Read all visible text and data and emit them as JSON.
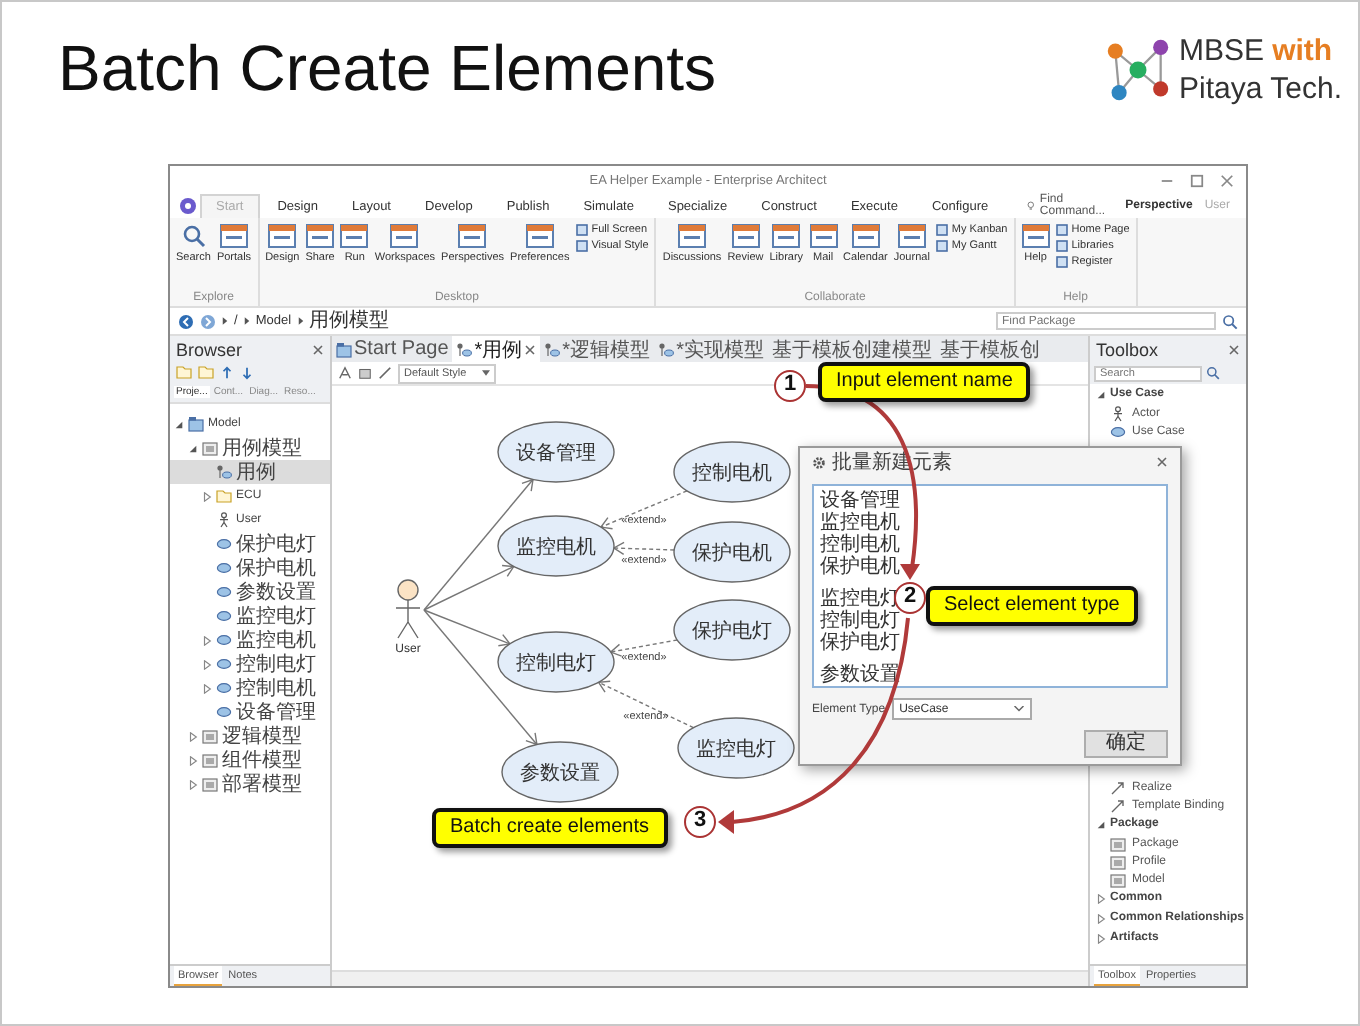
{
  "slide": {
    "title": "Batch Create Elements"
  },
  "logo": {
    "brand": "MBSE",
    "accent": "with",
    "company": "Pitaya Tech."
  },
  "window": {
    "title": "EA Helper Example - Enterprise Architect"
  },
  "ribbon": {
    "tabs": [
      {
        "label": "Start",
        "selected": true
      },
      {
        "label": "Design",
        "selected": false
      },
      {
        "label": "Layout",
        "selected": false
      },
      {
        "label": "Develop",
        "selected": false
      },
      {
        "label": "Publish",
        "selected": false
      },
      {
        "label": "Simulate",
        "selected": false
      },
      {
        "label": "Specialize",
        "selected": false
      },
      {
        "label": "Construct",
        "selected": false
      },
      {
        "label": "Execute",
        "selected": false
      },
      {
        "label": "Configure",
        "selected": false
      }
    ],
    "find_command": "Find Command...",
    "perspective": "Perspective",
    "user": "User",
    "groups": [
      {
        "name": "Explore",
        "items": [
          {
            "label": "Search",
            "kind": "search"
          },
          {
            "label": "Portals",
            "kind": "large"
          }
        ]
      },
      {
        "name": "Desktop",
        "items": [
          {
            "label": "Design",
            "kind": "large"
          },
          {
            "label": "Share",
            "kind": "large"
          },
          {
            "label": "Run",
            "kind": "large"
          },
          {
            "label": "Workspaces",
            "kind": "large"
          },
          {
            "label": "Perspectives",
            "kind": "large"
          },
          {
            "label": "Preferences",
            "kind": "large"
          },
          {
            "label": "Full Screen",
            "kind": "small"
          },
          {
            "label": "Visual Style",
            "kind": "small"
          }
        ]
      },
      {
        "name": "Collaborate",
        "items": [
          {
            "label": "Discussions",
            "kind": "large"
          },
          {
            "label": "Review",
            "kind": "large"
          },
          {
            "label": "Library",
            "kind": "large"
          },
          {
            "label": "Mail",
            "kind": "large"
          },
          {
            "label": "Calendar",
            "kind": "large"
          },
          {
            "label": "Journal",
            "kind": "large"
          },
          {
            "label": "My Kanban",
            "kind": "small"
          },
          {
            "label": "My Gantt",
            "kind": "small"
          }
        ]
      },
      {
        "name": "Help",
        "items": [
          {
            "label": "Help",
            "kind": "large"
          },
          {
            "label": "Home Page",
            "kind": "small"
          },
          {
            "label": "Libraries",
            "kind": "small"
          },
          {
            "label": "Register",
            "kind": "small"
          }
        ]
      }
    ]
  },
  "address_bar": {
    "path": [
      "/",
      "Model",
      "用例模型"
    ],
    "find_placeholder": "Find Package"
  },
  "browser": {
    "title": "Browser",
    "tabs": [
      {
        "label": "Proje...",
        "selected": true
      },
      {
        "label": "Cont...",
        "selected": false
      },
      {
        "label": "Diag...",
        "selected": false
      },
      {
        "label": "Reso...",
        "selected": false
      }
    ],
    "tree": [
      {
        "label": "Model",
        "kind": "model",
        "selected": false,
        "expanded": true,
        "children": [
          {
            "label": "用例模型",
            "kind": "package",
            "selected": false,
            "expanded": true,
            "children": [
              {
                "label": "用例",
                "kind": "diagram",
                "selected": true
              },
              {
                "label": "ECU",
                "kind": "folder",
                "selected": false,
                "expanded": false
              },
              {
                "label": "User",
                "kind": "actor",
                "selected": false
              },
              {
                "label": "保护电灯",
                "kind": "usecase",
                "selected": false
              },
              {
                "label": "保护电机",
                "kind": "usecase",
                "selected": false
              },
              {
                "label": "参数设置",
                "kind": "usecase",
                "selected": false
              },
              {
                "label": "监控电灯",
                "kind": "usecase",
                "selected": false
              },
              {
                "label": "监控电机",
                "kind": "usecase",
                "selected": false,
                "expanded": false
              },
              {
                "label": "控制电灯",
                "kind": "usecase",
                "selected": false,
                "expanded": false
              },
              {
                "label": "控制电机",
                "kind": "usecase",
                "selected": false,
                "expanded": false
              },
              {
                "label": "设备管理",
                "kind": "usecase",
                "selected": false
              }
            ]
          },
          {
            "label": "逻辑模型",
            "kind": "package",
            "selected": false,
            "expanded": false
          },
          {
            "label": "组件模型",
            "kind": "package",
            "selected": false,
            "expanded": false
          },
          {
            "label": "部署模型",
            "kind": "package",
            "selected": false,
            "expanded": false
          }
        ]
      }
    ],
    "bottom_tabs": [
      {
        "label": "Browser",
        "selected": true
      },
      {
        "label": "Notes",
        "selected": false
      }
    ]
  },
  "diagram_tabs": [
    {
      "label": "Start Page",
      "selected": false
    },
    {
      "label": "*用例",
      "selected": true
    },
    {
      "label": "*逻辑模型",
      "selected": false
    },
    {
      "label": "*实现模型",
      "selected": false
    },
    {
      "label": "基于模板创建模型",
      "selected": false
    },
    {
      "label": "基于模板创",
      "selected": false
    }
  ],
  "diagram": {
    "style": "Default Style",
    "actor": "User",
    "use_cases": [
      "设备管理",
      "监控电机",
      "控制电灯",
      "参数设置",
      "控制电机",
      "保护电机",
      "保护电灯",
      "监控电灯"
    ],
    "relations": [
      {
        "kind": "association"
      },
      {
        "kind": "association"
      },
      {
        "kind": "association"
      },
      {
        "kind": "association"
      },
      {
        "kind": "extend",
        "label": "«extend»"
      },
      {
        "kind": "extend",
        "label": "«extend»"
      },
      {
        "kind": "extend",
        "label": "«extend»"
      },
      {
        "kind": "extend",
        "label": "«extend»"
      }
    ]
  },
  "toolbox": {
    "title": "Toolbox",
    "search_placeholder": "Search",
    "groups": [
      {
        "name": "Use Case",
        "expanded": true,
        "items": [
          {
            "label": "Actor",
            "kind": "actor"
          },
          {
            "label": "Use Case",
            "kind": "usecase"
          },
          {
            "label": "Realize",
            "kind": "relation"
          },
          {
            "label": "Template Binding",
            "kind": "relation"
          }
        ]
      },
      {
        "name": "Package",
        "expanded": true,
        "items": [
          {
            "label": "Package",
            "kind": "package"
          },
          {
            "label": "Profile",
            "kind": "package"
          },
          {
            "label": "Model",
            "kind": "package"
          }
        ]
      },
      {
        "name": "Common",
        "expanded": false
      },
      {
        "name": "Common Relationships",
        "expanded": false
      },
      {
        "name": "Artifacts",
        "expanded": false
      }
    ],
    "bottom_tabs": [
      {
        "label": "Toolbox",
        "selected": true
      },
      {
        "label": "Properties",
        "selected": false
      }
    ]
  },
  "dialog": {
    "title": "批量新建元素",
    "lines": [
      {
        "text": "设备管理",
        "gap_before": false
      },
      {
        "text": "监控电机",
        "gap_before": false
      },
      {
        "text": "控制电机",
        "gap_before": false
      },
      {
        "text": "保护电机",
        "gap_before": false
      },
      {
        "text": "监控电灯",
        "gap_before": true
      },
      {
        "text": "控制电灯",
        "gap_before": false
      },
      {
        "text": "保护电灯",
        "gap_before": false
      },
      {
        "text": "参数设置",
        "gap_before": true
      }
    ],
    "element_type_label": "Element Type",
    "element_type": "UseCase",
    "ok_button": "确定"
  },
  "callouts": [
    {
      "number": "1",
      "text": "Input element name"
    },
    {
      "number": "2",
      "text": "Select element type"
    },
    {
      "number": "3",
      "text": "Batch create elements"
    }
  ]
}
